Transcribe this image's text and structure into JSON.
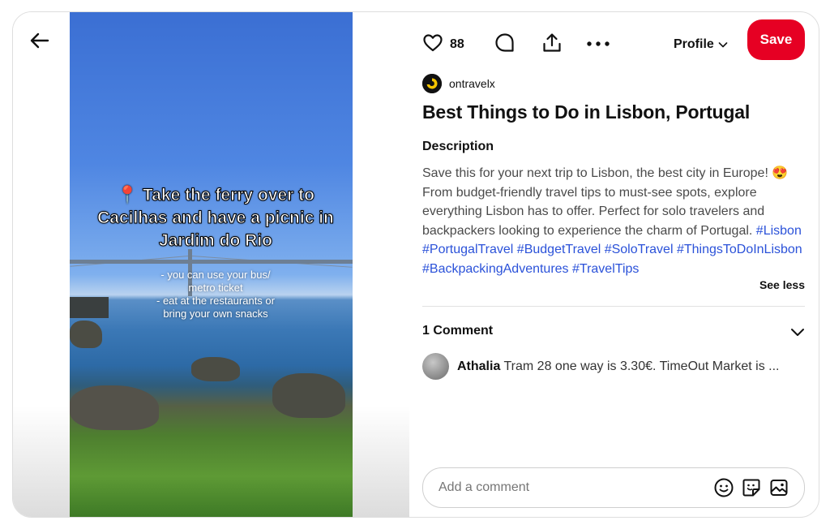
{
  "toolbar": {
    "likes_count": "88",
    "profile_label": "Profile",
    "save_label": "Save"
  },
  "video": {
    "title_overlay": "📍 Take the ferry over to Cacilhas and have a picnic in Jardim do Rio",
    "caption_lines": [
      "- you can use your bus/",
      "metro ticket",
      "- eat at the restaurants or",
      "bring your own snacks"
    ]
  },
  "pin": {
    "author": "ontravelx",
    "title": "Best Things to Do in Lisbon, Portugal",
    "description_heading": "Description",
    "description_text": "Save this for your next trip to Lisbon, the best city in Europe! 😍 From budget-friendly travel tips to must-see spots, explore everything Lisbon has to offer. Perfect for solo travelers and backpackers looking to experience the charm of Portugal.",
    "hashtags": "#Lisbon #PortugalTravel #BudgetTravel #SoloTravel #ThingsToDoInLisbon #BackpackingAdventures #TravelTips",
    "see_less_label": "See less"
  },
  "comments": {
    "heading": "1 Comment",
    "items": [
      {
        "author": "Athalia",
        "text": "Tram 28 one way is 3.30€. TimeOut Market is ..."
      }
    ],
    "input_placeholder": "Add a comment"
  },
  "colors": {
    "save_button": "#e60023",
    "hashtag": "#2b52d9"
  },
  "icons": [
    "back-arrow-icon",
    "heart-icon",
    "comment-icon",
    "share-icon",
    "more-icon",
    "chevron-down-icon",
    "emoji-icon",
    "sticker-icon",
    "image-icon"
  ]
}
